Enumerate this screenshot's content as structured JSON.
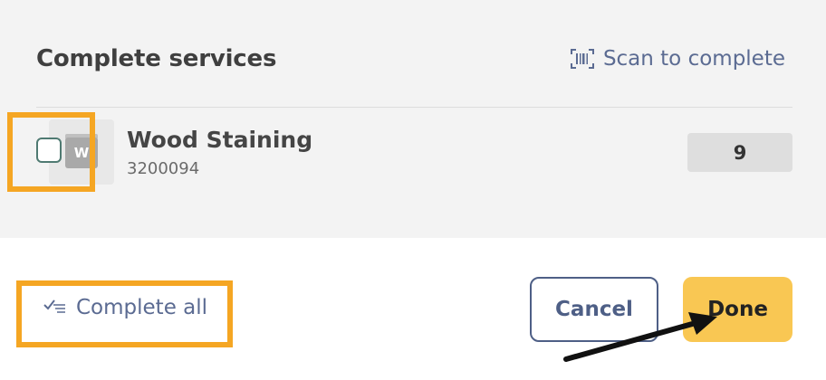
{
  "section": {
    "title": "Complete services",
    "scan_label": "Scan to complete"
  },
  "item": {
    "name": "Wood Staining",
    "code": "3200094",
    "thumb_letter": "W",
    "quantity": "9",
    "checked": false
  },
  "footer": {
    "complete_all_label": "Complete all",
    "cancel_label": "Cancel",
    "done_label": "Done"
  },
  "colors": {
    "link": "#5b6b92",
    "highlight": "#f5a623",
    "done_button": "#f9c753",
    "cancel_border": "#4e5f86"
  },
  "icons": {
    "scan": "barcode-scan-icon",
    "complete_all": "check-list-icon",
    "item": "service-box-icon"
  }
}
